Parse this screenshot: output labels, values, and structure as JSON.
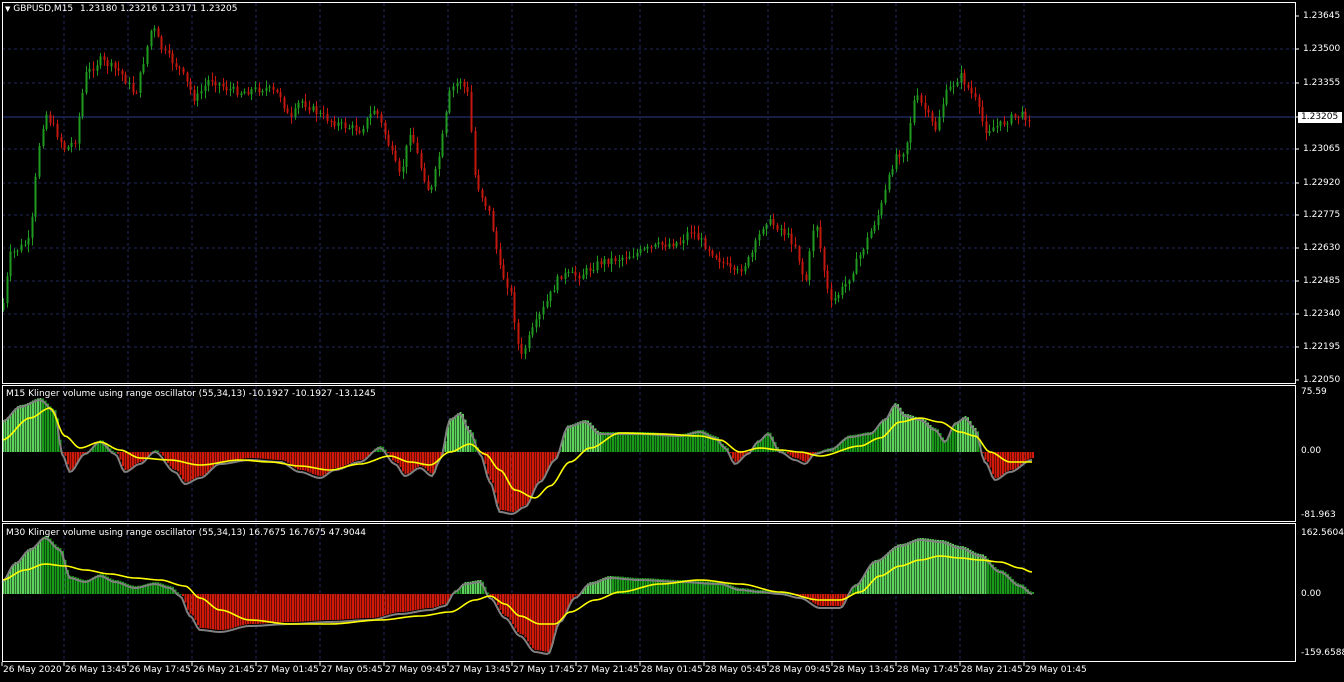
{
  "symbol": {
    "arrow_icon": "triangle-down-icon",
    "title": "GBPUSD,M15",
    "ohlc": "1.23180 1.23216 1.23171 1.23205"
  },
  "colors": {
    "background": "#000000",
    "grid": "#1f2a5a",
    "bull": "#1f9a1f",
    "bear": "#c4180f",
    "osc_light_green": "#5dd35d",
    "osc_green": "#1a9a1a",
    "osc_red": "#d11a0a",
    "osc_shadow": "#808080",
    "signal": "#ffff00",
    "bid_line": "#2a3a8a",
    "frame": "#ffffff"
  },
  "price_scale": [
    "1.23645",
    "1.23500",
    "1.23355",
    "1.23205",
    "1.23065",
    "1.22920",
    "1.22775",
    "1.22630",
    "1.22485",
    "1.22340",
    "1.22195",
    "1.22050"
  ],
  "current_price": "1.23205",
  "indicator_m15": {
    "label": "M15 Klinger volume using range oscillator (55,34,13) -10.1927 -10.1927 -13.1245",
    "scale": [
      "75.59",
      "0.00",
      "-81.963"
    ]
  },
  "indicator_m30": {
    "label": "M30 Klinger volume using range oscillator (55,34,13) 16.7675 16.7675 47.9044",
    "scale": [
      "162.5604",
      "0.00",
      "-159.6588"
    ]
  },
  "time_axis": [
    "26 May 2020",
    "26 May 13:45",
    "26 May 17:45",
    "26 May 21:45",
    "27 May 01:45",
    "27 May 05:45",
    "27 May 09:45",
    "27 May 13:45",
    "27 May 17:45",
    "27 May 21:45",
    "28 May 01:45",
    "28 May 05:45",
    "28 May 09:45",
    "28 May 13:45",
    "28 May 17:45",
    "28 May 21:45",
    "29 May 01:45"
  ]
}
